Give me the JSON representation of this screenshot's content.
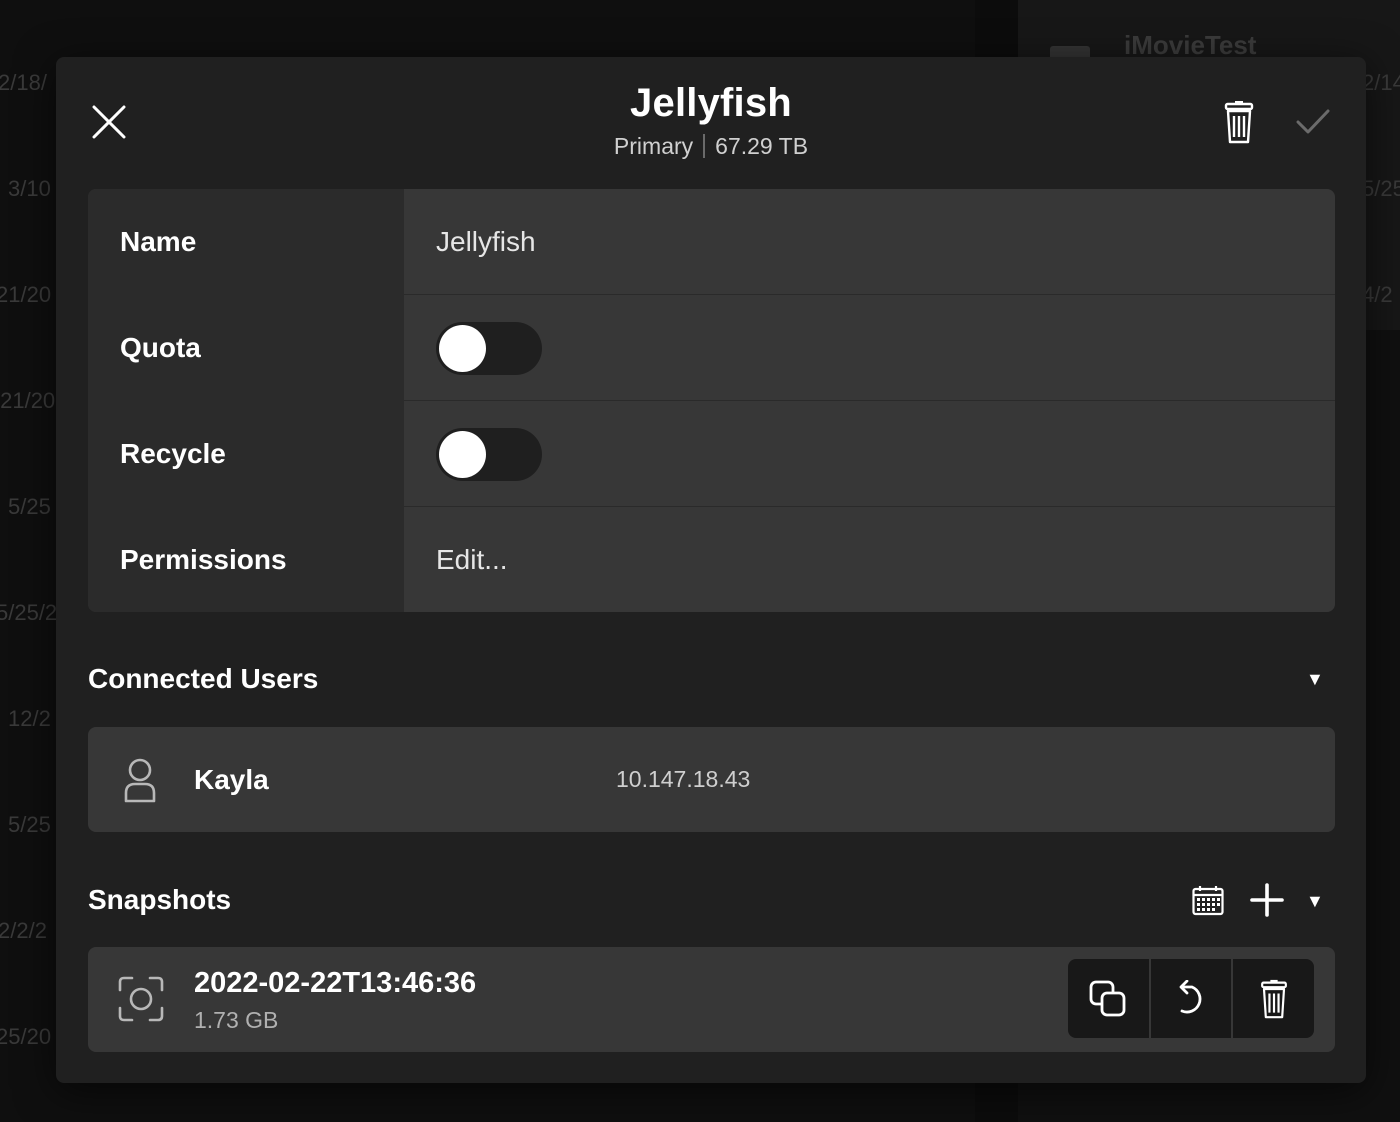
{
  "background": {
    "app_title": "iMovieTest",
    "left_dates": [
      "2/18/",
      "3/10",
      "21/20",
      "/21/20",
      "5/25",
      "5/25/2",
      "12/2",
      "5/25",
      "2/2/2",
      "25/20"
    ],
    "right_dates": [
      "2/14",
      "5/25",
      "4/2"
    ]
  },
  "modal": {
    "title": "Jellyfish",
    "subtitle_role": "Primary",
    "subtitle_size": "67.29 TB",
    "close_icon": "close-icon",
    "delete_icon": "trash-icon",
    "confirm_icon": "checkmark-icon"
  },
  "settings": {
    "name_label": "Name",
    "name_value": "Jellyfish",
    "quota_label": "Quota",
    "quota_enabled": false,
    "recycle_label": "Recycle",
    "recycle_enabled": false,
    "permissions_label": "Permissions",
    "permissions_value": "Edit..."
  },
  "connected_users": {
    "title": "Connected Users",
    "users": [
      {
        "name": "Kayla",
        "ip": "10.147.18.43",
        "icon": "user-icon"
      }
    ]
  },
  "snapshots": {
    "title": "Snapshots",
    "toolbar_icons": [
      "calendar-icon",
      "plus-icon",
      "caret-down-icon"
    ],
    "items": [
      {
        "name": "2022-02-22T13:46:36",
        "size": "1.73 GB",
        "icon": "snapshot-icon",
        "actions": [
          "copy-icon",
          "restore-icon",
          "trash-icon"
        ]
      }
    ]
  },
  "colors": {
    "modal_bg": "#202020",
    "row_bg": "#373737",
    "label_col_bg": "#2b2b2b",
    "action_bg": "#181818",
    "text": "#ffffff"
  }
}
